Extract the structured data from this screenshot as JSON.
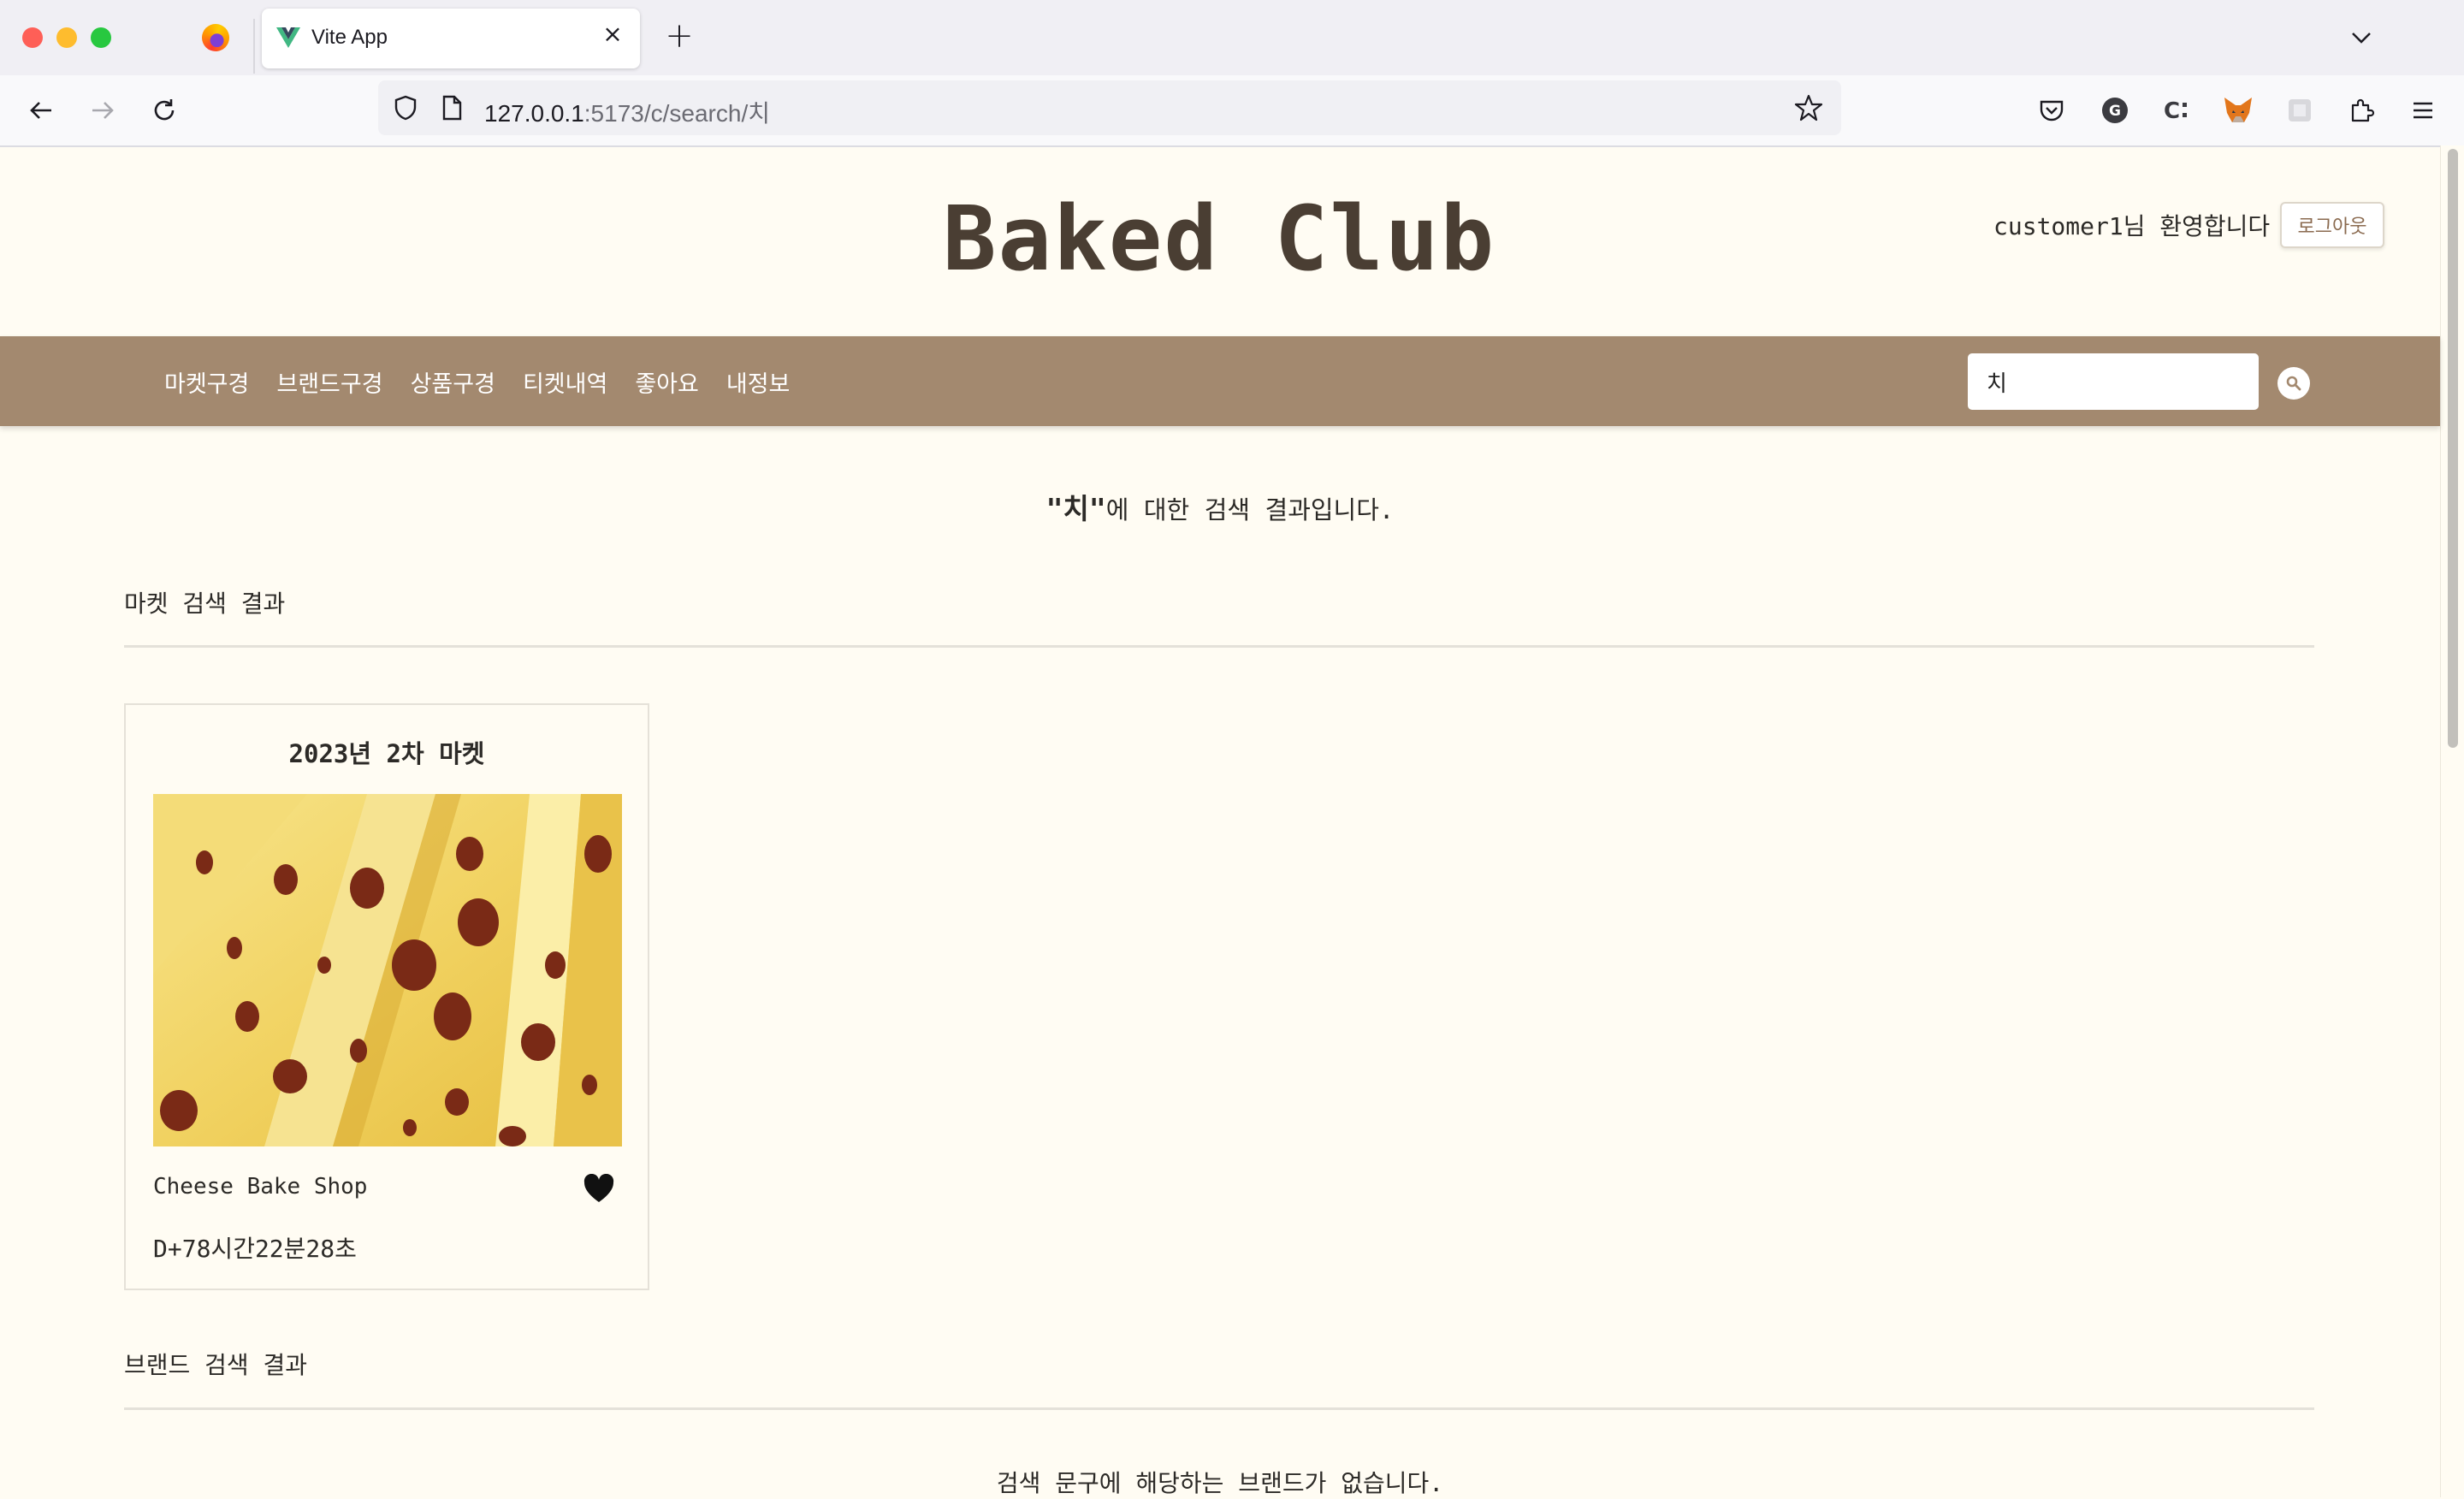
{
  "browser": {
    "tab_title": "Vite App",
    "url_host": "127.0.0.1",
    "url_rest": ":5173/c/search/치"
  },
  "site": {
    "title": "Baked Club",
    "welcome": "customer1님 환영합니다",
    "logout_label": "로그아웃"
  },
  "menu": {
    "items": [
      {
        "label": "마켓구경"
      },
      {
        "label": "브랜드구경"
      },
      {
        "label": "상품구경"
      },
      {
        "label": "티켓내역"
      },
      {
        "label": "좋아요"
      },
      {
        "label": "내정보"
      }
    ]
  },
  "search": {
    "value": "치"
  },
  "results": {
    "quote_open": "\"",
    "query": "치",
    "quote_close": "\"",
    "heading_suffix": "에 대한 검색 결과입니다.",
    "market_section_title": "마켓 검색 결과",
    "brand_section_title": "브랜드 검색 결과",
    "brand_empty_message": "검색 문구에 해당하는 브랜드가 없습니다."
  },
  "market_cards": [
    {
      "title": "2023년 2차 마켓",
      "image": "cheese-slices",
      "brand": "Cheese Bake Shop",
      "liked": true,
      "countdown": "D+78시간22분28초"
    }
  ],
  "colors": {
    "background": "#fffcf3",
    "menu_bar": "#a3896f",
    "title": "#4a3e33"
  }
}
